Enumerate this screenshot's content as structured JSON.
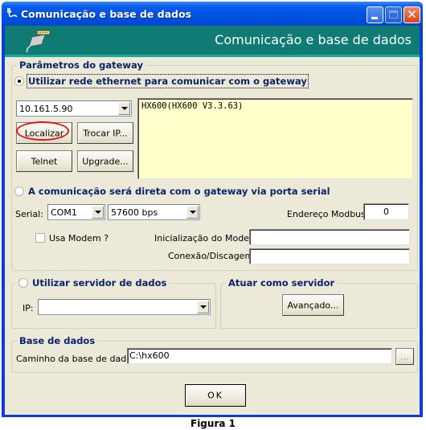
{
  "window": {
    "title": "Comunicação e base de dados",
    "icon": "plug-cable-icon",
    "controls": [
      "minimize",
      "maximize",
      "close"
    ],
    "close_glyph": "✕"
  },
  "header": {
    "title": "Comunicação e base de dados",
    "icon": "serial-connector-icon",
    "background": "#0f7b74"
  },
  "gateway": {
    "legend": "Parâmetros do gateway",
    "ethernet_option": {
      "label": "Utilizar rede ethernet para comunicar com o gateway",
      "checked": true
    },
    "ip_combo": {
      "value": "10.161.5.90"
    },
    "buttons": {
      "localizar": "Localizar",
      "trocar_ip": "Trocar IP...",
      "telnet": "Telnet",
      "upgrade": "Upgrade..."
    },
    "info_text": "HX600(HX600 V3.3.63)",
    "serial_option": {
      "label": "A comunicação será direta com o gateway via porta serial",
      "checked": false
    },
    "serial_label": "Serial:",
    "port_combo": {
      "value": "COM1"
    },
    "baud_combo": {
      "value": "57600 bps"
    },
    "modbus_label": "Endereço Modbus:",
    "modbus_value": "0",
    "use_modem": {
      "label": "Usa Modem ?",
      "checked": false
    },
    "modem_init_label": "Inicialização do Modem:",
    "modem_init_value": "",
    "dial_label": "Conexão/Discagem:",
    "dial_value": ""
  },
  "data_server": {
    "option": {
      "label": "Utilizar servidor de dados",
      "checked": false
    },
    "ip_label": "IP:",
    "ip_value": ""
  },
  "act_as_server": {
    "legend": "Atuar como servidor",
    "advanced_button": "Avançado..."
  },
  "database": {
    "legend": "Base de dados",
    "path_label": "Caminho da base de dados:",
    "path_value": "C:\\hx600",
    "browse_button": "..."
  },
  "ok_button": "OK",
  "caption": "Figura 1",
  "annotation": {
    "highlighted_control": "Localizar",
    "color": "#e01515"
  }
}
